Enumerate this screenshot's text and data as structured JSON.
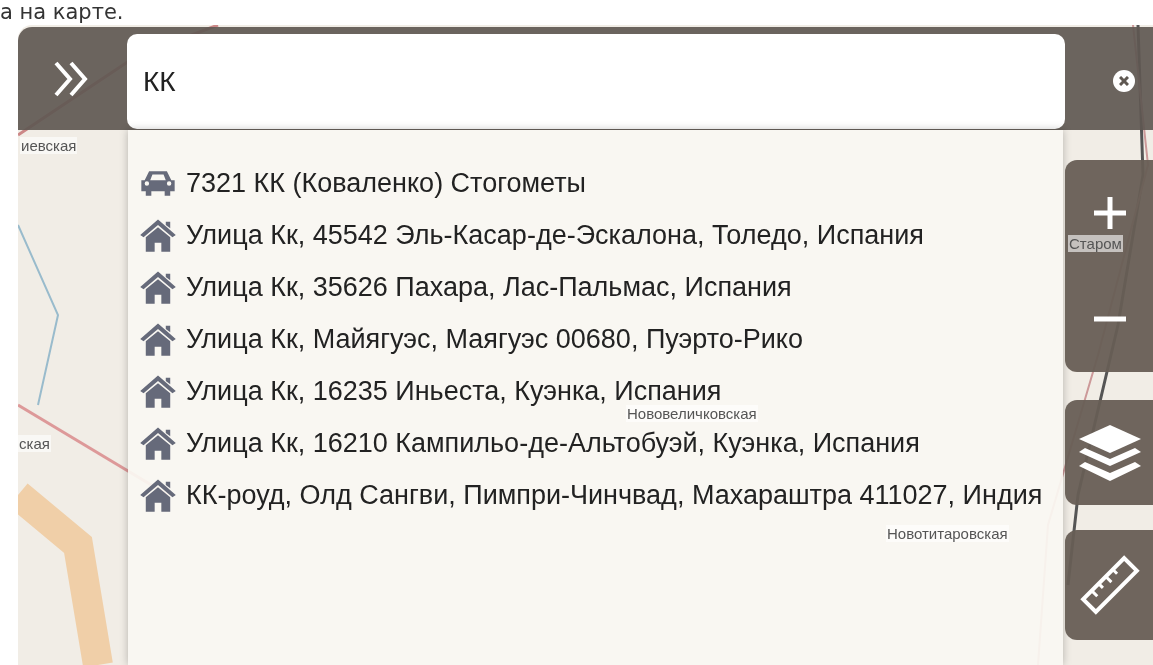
{
  "caption": "а на карте.",
  "search": {
    "value": "КК"
  },
  "map_labels": [
    "иевская",
    "ская",
    "Нововеличковская",
    "Новотитаровская",
    "Старом"
  ],
  "results": [
    {
      "kind": "vehicle",
      "text": "7321 КК (Коваленко) Стогометы"
    },
    {
      "kind": "address",
      "text": "Улица Кк, 45542 Эль-Касар-де-Эскалона, Толедо, Испания"
    },
    {
      "kind": "address",
      "text": "Улица Кк, 35626 Пахара, Лас-Пальмас, Испания"
    },
    {
      "kind": "address",
      "text": "Улица Кк, Майягуэс, Маягуэс 00680, Пуэрто-Рико"
    },
    {
      "kind": "address",
      "text": "Улица Кк, 16235 Иньеста, Куэнка, Испания"
    },
    {
      "kind": "address",
      "text": "Улица Кк, 16210 Кампильо-де-Альтобуэй, Куэнка, Испания"
    },
    {
      "kind": "address",
      "text": "КК-роуд, Олд Сангви, Пимпри-Чинчвад, Махараштра 411027, Индия"
    }
  ]
}
